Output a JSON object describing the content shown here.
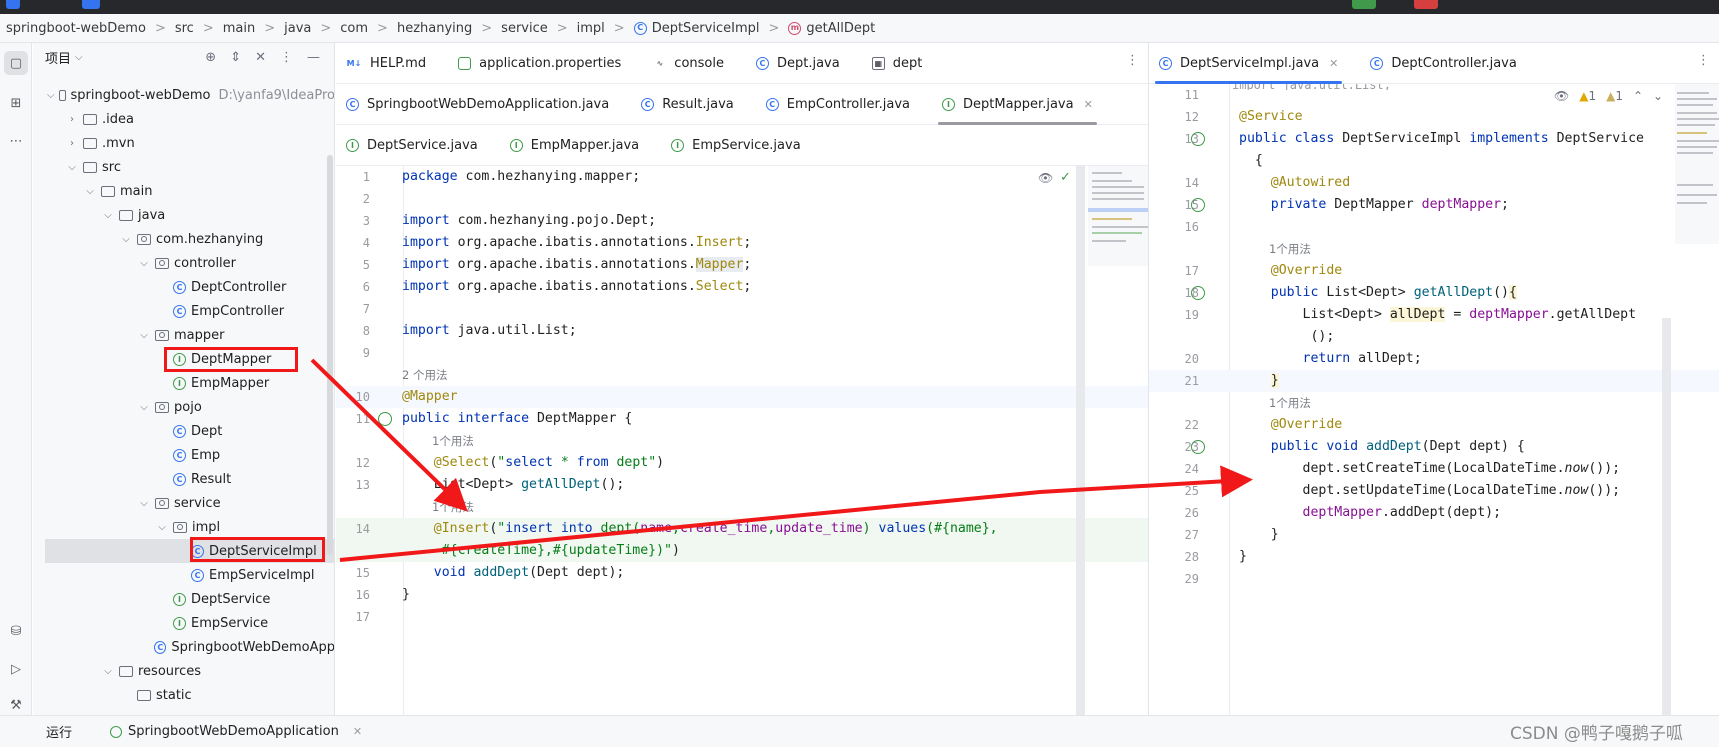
{
  "breadcrumb": [
    "springboot-webDemo",
    "src",
    "main",
    "java",
    "com",
    "hezhanying",
    "service",
    "impl",
    "DeptServiceImpl",
    "getAllDept"
  ],
  "project_panel": {
    "title": "项目",
    "tree": [
      {
        "label": "springboot-webDemo",
        "extra": "D:\\yanfa9\\IdeaPro",
        "kind": "module",
        "depth": 0,
        "open": true
      },
      {
        "label": ".idea",
        "kind": "folder",
        "depth": 1,
        "open": false
      },
      {
        "label": ".mvn",
        "kind": "folder",
        "depth": 1,
        "open": false
      },
      {
        "label": "src",
        "kind": "folder",
        "depth": 1,
        "open": true
      },
      {
        "label": "main",
        "kind": "folder",
        "depth": 2,
        "open": true
      },
      {
        "label": "java",
        "kind": "folder",
        "depth": 3,
        "open": true
      },
      {
        "label": "com.hezhanying",
        "kind": "pkg",
        "depth": 4,
        "open": true
      },
      {
        "label": "controller",
        "kind": "pkg",
        "depth": 5,
        "open": true
      },
      {
        "label": "DeptController",
        "kind": "cls",
        "depth": 6
      },
      {
        "label": "EmpController",
        "kind": "cls",
        "depth": 6
      },
      {
        "label": "mapper",
        "kind": "pkg",
        "depth": 5,
        "open": true
      },
      {
        "label": "DeptMapper",
        "kind": "itf",
        "depth": 6
      },
      {
        "label": "EmpMapper",
        "kind": "itf",
        "depth": 6
      },
      {
        "label": "pojo",
        "kind": "pkg",
        "depth": 5,
        "open": true
      },
      {
        "label": "Dept",
        "kind": "cls",
        "depth": 6
      },
      {
        "label": "Emp",
        "kind": "cls",
        "depth": 6
      },
      {
        "label": "Result",
        "kind": "cls",
        "depth": 6
      },
      {
        "label": "service",
        "kind": "pkg",
        "depth": 5,
        "open": true
      },
      {
        "label": "impl",
        "kind": "pkg",
        "depth": 6,
        "open": true
      },
      {
        "label": "DeptServiceImpl",
        "kind": "cls",
        "depth": 7,
        "selected": true
      },
      {
        "label": "EmpServiceImpl",
        "kind": "cls",
        "depth": 7
      },
      {
        "label": "DeptService",
        "kind": "itf",
        "depth": 6
      },
      {
        "label": "EmpService",
        "kind": "itf",
        "depth": 6
      },
      {
        "label": "SpringbootWebDemoApp",
        "kind": "cls",
        "depth": 5
      },
      {
        "label": "resources",
        "kind": "folder",
        "depth": 3,
        "open": true
      },
      {
        "label": "static",
        "kind": "folder",
        "depth": 4
      }
    ]
  },
  "left_editor": {
    "tab_rows": [
      [
        {
          "label": "HELP.md",
          "icon": "md"
        },
        {
          "label": "application.properties",
          "icon": "prop"
        },
        {
          "label": "console",
          "icon": "con"
        },
        {
          "label": "Dept.java",
          "icon": "c"
        },
        {
          "label": "dept",
          "icon": "tbl"
        }
      ],
      [
        {
          "label": "SpringbootWebDemoApplication.java",
          "icon": "c"
        },
        {
          "label": "Result.java",
          "icon": "c"
        },
        {
          "label": "EmpController.java",
          "icon": "c"
        },
        {
          "label": "DeptMapper.java",
          "icon": "i",
          "active": true
        }
      ],
      [
        {
          "label": "DeptService.java",
          "icon": "i"
        },
        {
          "label": "EmpMapper.java",
          "icon": "i"
        },
        {
          "label": "EmpService.java",
          "icon": "i"
        }
      ]
    ],
    "lines": [
      {
        "n": "1",
        "html": "<span class=\"kw\">package</span> com.hezhanying.mapper;"
      },
      {
        "n": "2",
        "html": ""
      },
      {
        "n": "3",
        "html": "<span class=\"kw\">import</span> com.hezhanying.pojo.Dept;"
      },
      {
        "n": "4",
        "html": "<span class=\"kw\">import</span> org.apache.ibatis.annotations.<span class=\"an\">Insert</span>;"
      },
      {
        "n": "5",
        "html": "<span class=\"kw\">import</span> org.apache.ibatis.annotations.<span class=\"an hl-gr\">Mapper</span>;"
      },
      {
        "n": "6",
        "html": "<span class=\"kw\">import</span> org.apache.ibatis.annotations.<span class=\"an\">Select</span>;"
      },
      {
        "n": "7",
        "html": ""
      },
      {
        "n": "8",
        "html": "<span class=\"kw\">import</span> java.util.List;"
      },
      {
        "n": "9",
        "html": ""
      },
      {
        "n": "",
        "hint": "2 个用法",
        "indent": 0
      },
      {
        "n": "10",
        "html": "<span class=\"an\">@Mapper</span>",
        "cls": "cur"
      },
      {
        "n": "11",
        "html": "<span class=\"kw\">public interface</span> DeptMapper {",
        "gutter": true
      },
      {
        "n": "",
        "hint": "1个用法",
        "indent": 1
      },
      {
        "n": "12",
        "html": "    <span class=\"an\">@Select</span>(<span class=\"str\">\"</span><span class=\"kw\">select</span> <span class=\"str\">*</span> <span class=\"kw\">from</span> <span class=\"str\">dept\"</span>)"
      },
      {
        "n": "13",
        "html": "    List&lt;Dept&gt; <span class=\"fn\">getAllDept</span>();"
      },
      {
        "n": "",
        "hint": "1个用法",
        "indent": 1
      },
      {
        "n": "14",
        "html": "    <span class=\"an\">@Insert</span>(<span class=\"str\">\"</span><span class=\"kw\">insert into</span> <span class=\"str\">dept(</span><span class=\"fld\">name</span><span class=\"str\">,</span><span class=\"fld\">create_time</span><span class=\"str\">,</span><span class=\"fld\">update_time</span><span class=\"str\">)</span> <span class=\"kw\">values</span><span class=\"str\">(#{name},</span>",
        "cls": "soft"
      },
      {
        "n": "",
        "html": "     <span class=\"str\">#{createTime},#{updateTime})\"</span>)",
        "cls": "soft"
      },
      {
        "n": "15",
        "html": "    <span class=\"kw\">void</span> <span class=\"fn\">addDept</span>(Dept dept);"
      },
      {
        "n": "16",
        "html": "}"
      },
      {
        "n": "17",
        "html": ""
      }
    ]
  },
  "right_editor": {
    "tabs": [
      {
        "label": "DeptServiceImpl.java",
        "icon": "c",
        "active": true
      },
      {
        "label": "DeptController.java",
        "icon": "c"
      }
    ],
    "inspection": {
      "warnings": "1",
      "weak_warnings": "1"
    },
    "lines": [
      {
        "n": "11",
        "html": ""
      },
      {
        "n": "12",
        "html": "<span class=\"an\">@Service</span>"
      },
      {
        "n": "13",
        "html": "<span class=\"kw\">public class</span> DeptServiceImpl <span class=\"kw\">implements</span> DeptService",
        "gutter": true
      },
      {
        "n": "",
        "html": "  {"
      },
      {
        "n": "14",
        "html": "    <span class=\"an\">@Autowired</span>"
      },
      {
        "n": "15",
        "html": "    <span class=\"kw\">private</span> DeptMapper <span class=\"fld\">deptMapper</span>;",
        "gutter": true
      },
      {
        "n": "16",
        "html": ""
      },
      {
        "n": "",
        "hint": "1个用法",
        "indent": 1
      },
      {
        "n": "17",
        "html": "    <span class=\"an\">@Override</span>"
      },
      {
        "n": "18",
        "html": "    <span class=\"kw\">public</span> List&lt;Dept&gt; <span class=\"fn\">getAllDept</span>()<span class=\"hl-yel\">{</span>",
        "gutter": true
      },
      {
        "n": "19",
        "html": "        List&lt;Dept&gt; <span class=\"hl-yel\">allDept</span> = <span class=\"fld\">deptMapper</span>.getAllDept"
      },
      {
        "n": "",
        "html": "         ();"
      },
      {
        "n": "20",
        "html": "        <span class=\"kw\">return</span> allDept;"
      },
      {
        "n": "21",
        "html": "    <span class=\"hl-yel\">}</span>",
        "cls": "cur"
      },
      {
        "n": "",
        "hint": "1个用法",
        "indent": 1
      },
      {
        "n": "22",
        "html": "    <span class=\"an\">@Override</span>"
      },
      {
        "n": "23",
        "html": "    <span class=\"kw\">public void</span> <span class=\"fn\">addDept</span>(Dept dept) {",
        "gutter": true
      },
      {
        "n": "24",
        "html": "        dept.setCreateTime(LocalDateTime.<span class=\"it\">now</span>());"
      },
      {
        "n": "25",
        "html": "        dept.setUpdateTime(LocalDateTime.<span class=\"it\">now</span>());"
      },
      {
        "n": "26",
        "html": "        <span class=\"fld\">deptMapper</span>.addDept(dept);"
      },
      {
        "n": "27",
        "html": "    }"
      },
      {
        "n": "28",
        "html": "}"
      },
      {
        "n": "29",
        "html": ""
      }
    ]
  },
  "bottom": {
    "run_label": "运行",
    "run_config": "SpringbootWebDemoApplication"
  },
  "watermark": "CSDN @鸭子嘎鹅子呱",
  "colors": {
    "annotation_box": "#f01818",
    "arrow": "#f01818",
    "accent": "#3574f0"
  }
}
